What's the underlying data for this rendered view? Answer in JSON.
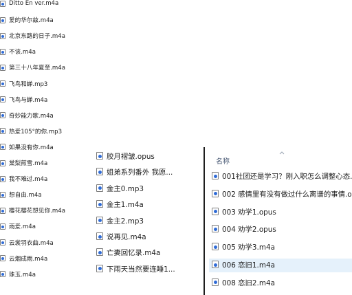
{
  "column_left": {
    "files": [
      "Ditto En ver.m4a",
      "爱的华尔兹.m4a",
      "北京东路的日子.m4a",
      "不该.m4a",
      "第三十八年夏至.m4a",
      "飞鸟和蝉.mp3",
      "飞鸟与蝉.m4a",
      "奇妙能力歌.m4a",
      "热爱105°的你.mp3",
      "如果没有你.m4a",
      "棠梨煎雪.m4a",
      "我不难过.m4a",
      "想自由.m4a",
      "樱花樱花想见你.m4a",
      "雨爱.m4a",
      "云裳羽衣曲.m4a",
      "云烟成雨.m4a",
      "珠玉.m4a"
    ]
  },
  "column_middle": {
    "files": [
      "胶月褶皱.opus",
      "姐弟系列番外 我愿...",
      "金主0.mp3",
      "金主1.m4a",
      "金主2.mp3",
      "说再见.m4a",
      "亡妻回忆录.m4a",
      "下雨天当然要连睡1..."
    ]
  },
  "detail_panel": {
    "column_header": "名称",
    "sort_icon": "chevron-up-icon",
    "selected_color": "#e5f1fb",
    "files": [
      "001社团还是学习？刚入职怎么调整心态...",
      "002 感情里有没有做过什么离谱的事情.o...",
      "003 劝学1.opus",
      "004 劝学2.opus",
      "005 劝学3.m4a",
      "006 恋旧1.m4a",
      "008 恋旧2.m4a"
    ],
    "selected_index": 5
  },
  "icon_name": "audio-file-icon",
  "accent_color": "#2f6bd6"
}
